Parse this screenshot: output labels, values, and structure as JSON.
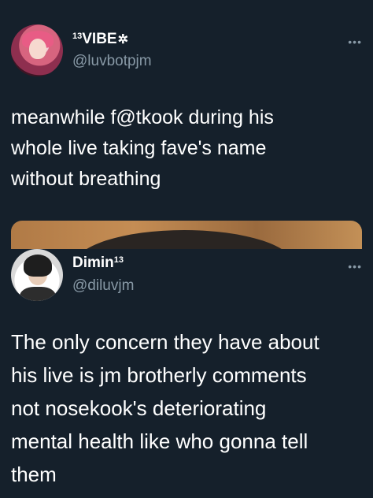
{
  "tweets": [
    {
      "display_name": "13VIBE",
      "name_superscript": "13",
      "name_main": "VIBE",
      "name_icon": "✲",
      "handle": "@luvbotpjm",
      "more": "•••",
      "text_lines": [
        "meanwhile f@tkook during his",
        "whole live taking fave's name",
        "without breathing"
      ]
    },
    {
      "display_name": "Dimin13",
      "name_main": "Dimin",
      "name_superscript": "13",
      "handle": "@diluvjm",
      "more": "•••",
      "text_lines": [
        "The only concern they have about",
        "his live is jm brotherly comments",
        "not nosekook's deteriorating",
        "mental health like who gonna tell",
        "them"
      ]
    }
  ],
  "colors": {
    "background": "#15202b",
    "text": "#ffffff",
    "secondary": "#8899a6"
  },
  "icons": {
    "more": "more-options-icon",
    "name_badge": "sparkle-icon"
  }
}
